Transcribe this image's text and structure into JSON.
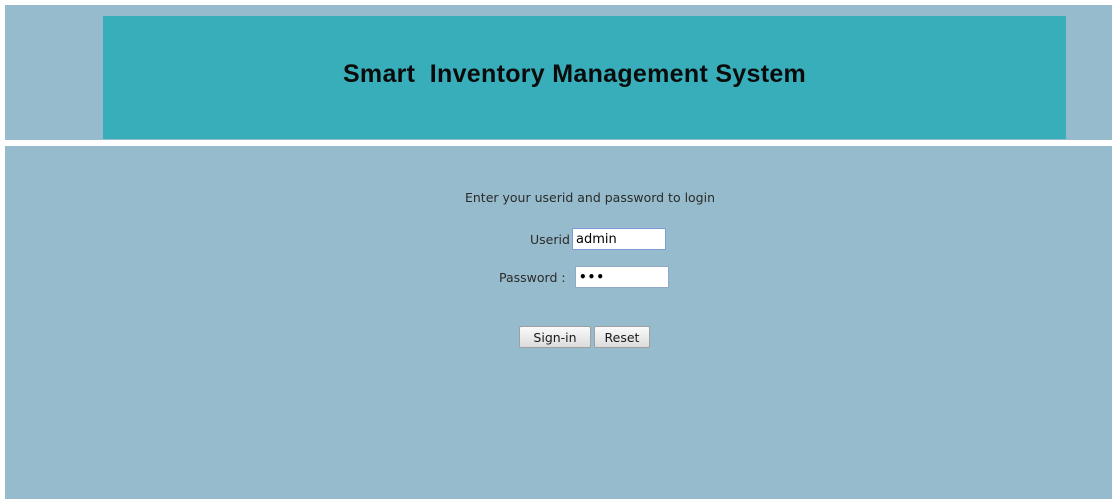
{
  "header": {
    "title": "Smart  Inventory Management System"
  },
  "login": {
    "instruction": "Enter your userid and password to login",
    "userid_label": "Userid",
    "userid_value": "admin",
    "password_label": "Password :",
    "password_value": "abc",
    "signin_label": "Sign-in",
    "reset_label": "Reset"
  },
  "colors": {
    "page_background": "#95bbcc",
    "banner_background": "#37aeba"
  }
}
